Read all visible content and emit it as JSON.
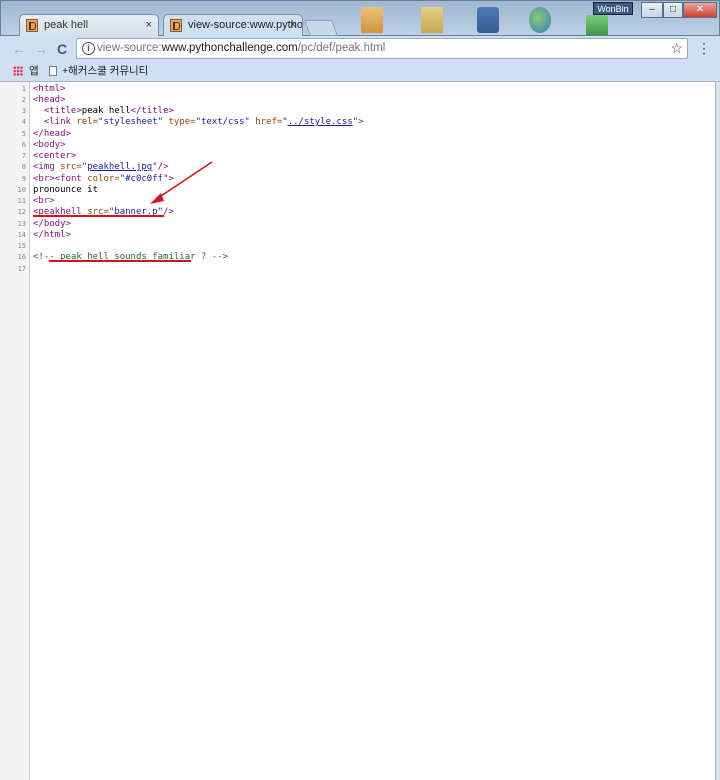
{
  "window": {
    "user_chip": "WonBin",
    "controls": {
      "minimize": "–",
      "maximize": "□",
      "close": "✕"
    }
  },
  "tabs": [
    {
      "label": "peak hell",
      "close": "×",
      "active": false
    },
    {
      "label": "view-source:www.pytho",
      "close": "×",
      "active": true
    }
  ],
  "toolbar": {
    "back": "←",
    "forward": "→",
    "reload": "C",
    "url_prefix": "view-source:",
    "url_host": "www.pythonchallenge.com",
    "url_path": "/pc/def/peak.html",
    "star": "☆",
    "menu": "⋮"
  },
  "bookmarks": {
    "apps_label": "앱",
    "item_label": "+해커스쿨 커뮤니티"
  },
  "source": {
    "lines": [
      {
        "n": "1",
        "parts": [
          [
            "tag",
            "<html>"
          ]
        ]
      },
      {
        "n": "2",
        "parts": [
          [
            "tag",
            "<head>"
          ]
        ]
      },
      {
        "n": "3",
        "parts": [
          [
            "txt",
            "  "
          ],
          [
            "tag",
            "<title>"
          ],
          [
            "txt",
            "peak hell"
          ],
          [
            "tag",
            "</title>"
          ]
        ]
      },
      {
        "n": "4",
        "parts": [
          [
            "txt",
            "  "
          ],
          [
            "tag",
            "<link "
          ],
          [
            "attr",
            "rel="
          ],
          [
            "val",
            "\"stylesheet\""
          ],
          [
            "txt",
            " "
          ],
          [
            "attr",
            "type="
          ],
          [
            "val",
            "\"text/css\""
          ],
          [
            "txt",
            " "
          ],
          [
            "attr",
            "href="
          ],
          [
            "val",
            "\""
          ],
          [
            "lnk",
            "../style.css"
          ],
          [
            "val",
            "\""
          ],
          [
            "tag",
            ">"
          ]
        ]
      },
      {
        "n": "5",
        "parts": [
          [
            "tag",
            "</head>"
          ]
        ]
      },
      {
        "n": "6",
        "parts": [
          [
            "tag",
            "<body>"
          ]
        ]
      },
      {
        "n": "7",
        "parts": [
          [
            "tag",
            "<center>"
          ]
        ]
      },
      {
        "n": "8",
        "parts": [
          [
            "tag",
            "<img "
          ],
          [
            "attr",
            "src="
          ],
          [
            "val",
            "\""
          ],
          [
            "lnk",
            "peakhell.jpg"
          ],
          [
            "val",
            "\""
          ],
          [
            "tag",
            "/>"
          ]
        ]
      },
      {
        "n": "9",
        "parts": [
          [
            "tag",
            "<br>"
          ],
          [
            "tag",
            "<font "
          ],
          [
            "attr",
            "color="
          ],
          [
            "val",
            "\"#c0c0ff\""
          ],
          [
            "tag",
            ">"
          ]
        ]
      },
      {
        "n": "10",
        "parts": [
          [
            "txt",
            "pronounce it"
          ]
        ]
      },
      {
        "n": "11",
        "parts": [
          [
            "tag",
            "<br>"
          ]
        ]
      },
      {
        "n": "12",
        "parts": [
          [
            "tag",
            "<peakhell "
          ],
          [
            "attr",
            "src="
          ],
          [
            "val",
            "\""
          ],
          [
            "lnk",
            "banner.p"
          ],
          [
            "val",
            "\""
          ],
          [
            "tag",
            "/>"
          ]
        ]
      },
      {
        "n": "13",
        "parts": [
          [
            "tag",
            "</body>"
          ]
        ]
      },
      {
        "n": "14",
        "parts": [
          [
            "tag",
            "</html>"
          ]
        ]
      },
      {
        "n": "15",
        "parts": []
      },
      {
        "n": "16",
        "parts": [
          [
            "cmt",
            "<!-- peak hell sounds familiar ? -->"
          ]
        ]
      },
      {
        "n": "17",
        "parts": []
      }
    ]
  },
  "colors": {
    "annotation": "#d2141c",
    "tag": "#881280",
    "attr": "#994500",
    "value": "#1a1aa6",
    "comment": "#236e25"
  }
}
